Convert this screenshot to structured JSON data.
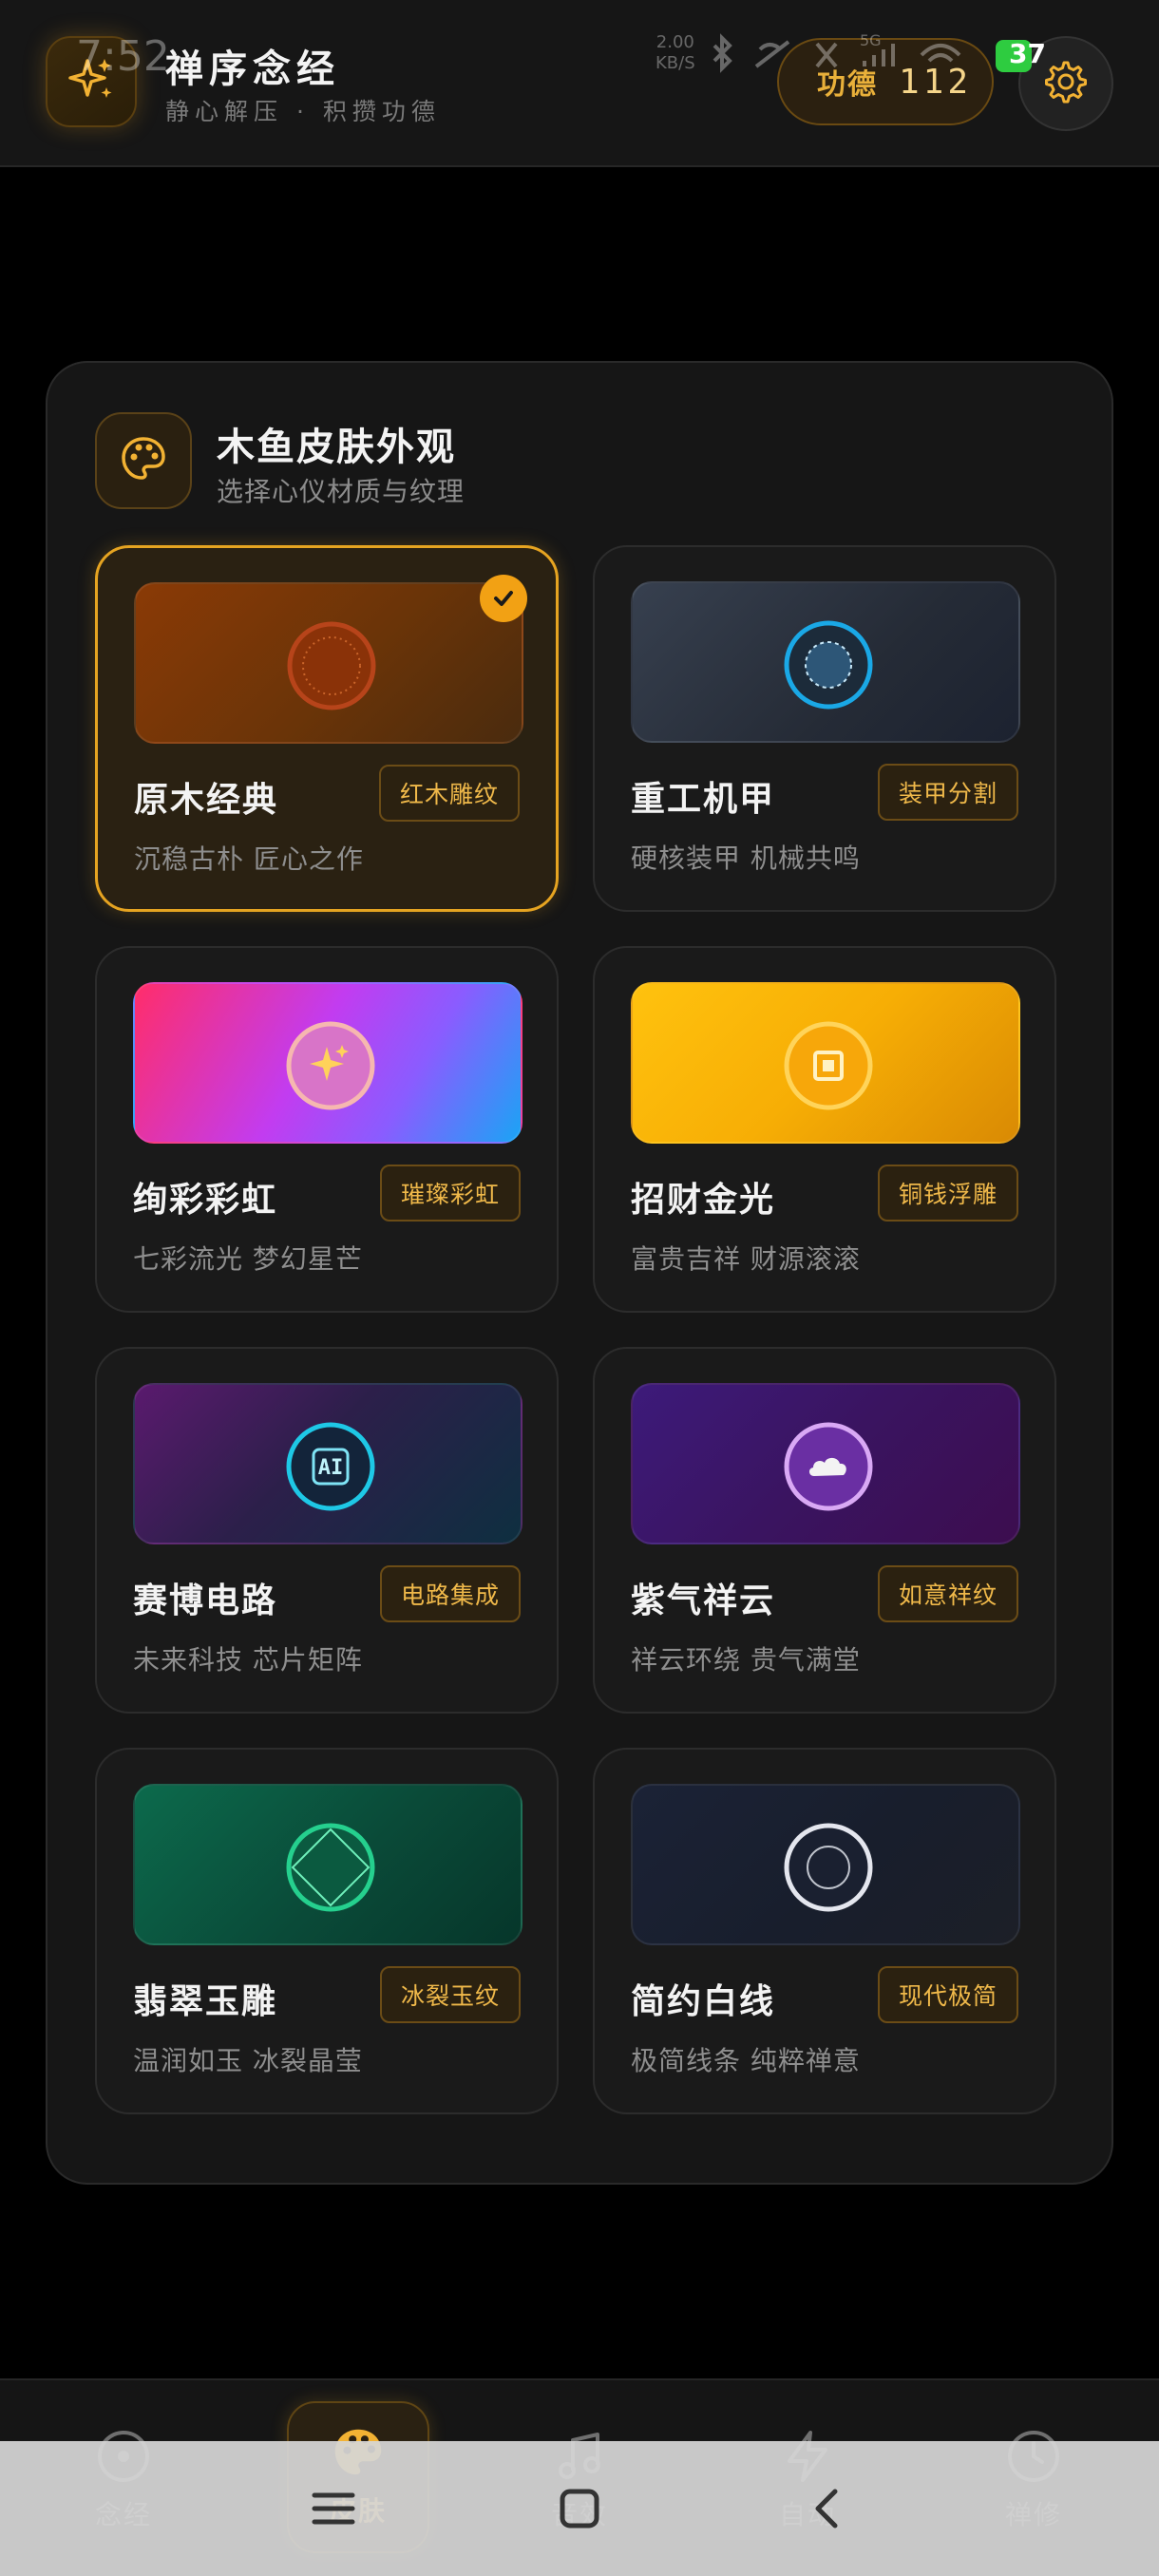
{
  "status_bar": {
    "time": "7:52",
    "speed_value": "2.00",
    "speed_unit": "KB/S",
    "battery": "37",
    "network": "5G"
  },
  "header": {
    "title": "禅序念经",
    "subtitle": "静心解压 · 积攒功德",
    "merit_label": "功德",
    "merit_value": "112",
    "logo_icon": "sparkles-icon",
    "settings_icon": "gear-icon",
    "accent_color": "#f2a820"
  },
  "skin_panel": {
    "title": "木鱼皮肤外观",
    "subtitle": "选择心仪材质与纹理",
    "icon": "palette-icon",
    "skins": [
      {
        "name": "原木经典",
        "tag": "红木雕纹",
        "desc": "沉稳古朴 匠心之作",
        "icon": "wood-ring-icon",
        "selected": true
      },
      {
        "name": "重工机甲",
        "tag": "装甲分割",
        "desc": "硬核装甲 机械共鸣",
        "icon": "mech-core-icon",
        "selected": false
      },
      {
        "name": "绚彩彩虹",
        "tag": "璀璨彩虹",
        "desc": "七彩流光 梦幻星芒",
        "icon": "sparkles-icon",
        "selected": false
      },
      {
        "name": "招财金光",
        "tag": "铜钱浮雕",
        "desc": "富贵吉祥 财源滚滚",
        "icon": "coin-icon",
        "selected": false
      },
      {
        "name": "赛博电路",
        "tag": "电路集成",
        "desc": "未来科技 芯片矩阵",
        "icon": "ai-chip-icon",
        "icon_text": "AI",
        "selected": false
      },
      {
        "name": "紫气祥云",
        "tag": "如意祥纹",
        "desc": "祥云环绕 贵气满堂",
        "icon": "cloud-icon",
        "selected": false
      },
      {
        "name": "翡翠玉雕",
        "tag": "冰裂玉纹",
        "desc": "温润如玉 冰裂晶莹",
        "icon": "jade-diamond-icon",
        "selected": false
      },
      {
        "name": "简约白线",
        "tag": "现代极简",
        "desc": "极简线条 纯粹禅意",
        "icon": "ring-icon",
        "selected": false
      }
    ]
  },
  "bottom_nav": {
    "items": [
      {
        "label": "念经",
        "icon": "disc-icon",
        "active": false
      },
      {
        "label": "皮肤",
        "icon": "palette-icon",
        "active": true
      },
      {
        "label": "音效",
        "icon": "music-note-icon",
        "active": false
      },
      {
        "label": "自动",
        "icon": "lightning-icon",
        "active": false
      },
      {
        "label": "禅修",
        "icon": "clock-icon",
        "active": false
      }
    ]
  },
  "system_nav": {
    "menu_icon": "menu-icon",
    "home_icon": "home-square-icon",
    "back_icon": "back-chevron-icon"
  }
}
